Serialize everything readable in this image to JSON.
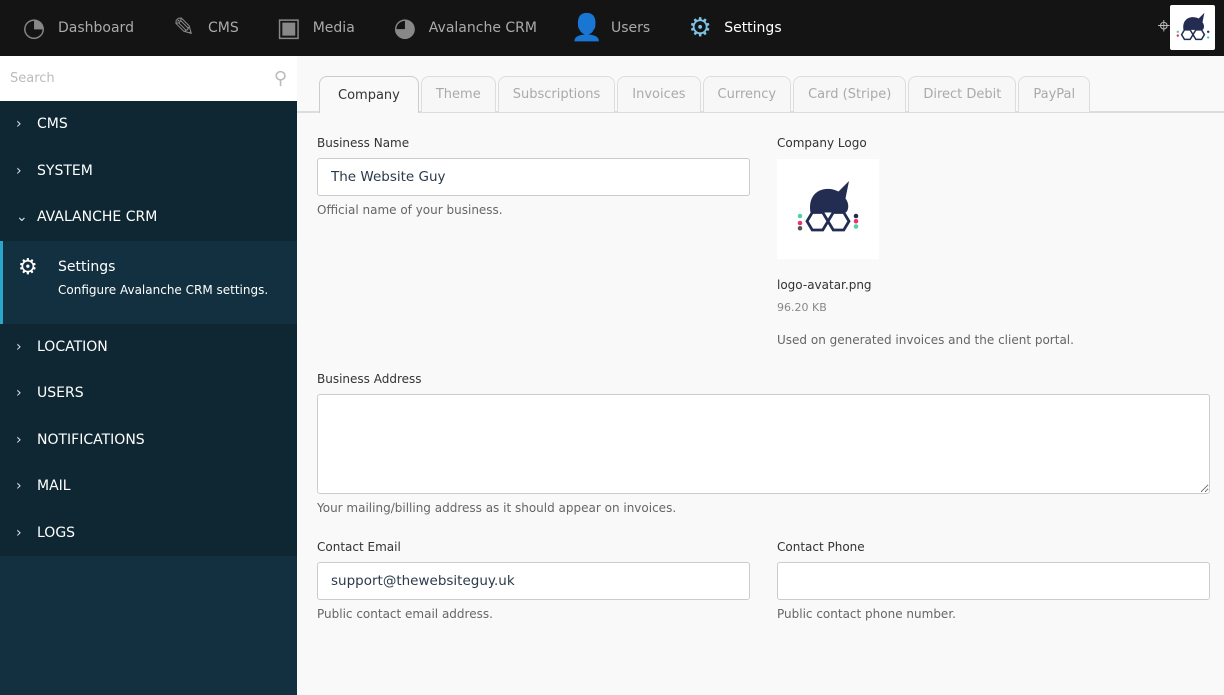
{
  "topnav": [
    {
      "label": "Dashboard",
      "icon": "dashboard-icon"
    },
    {
      "label": "CMS",
      "icon": "cms-icon"
    },
    {
      "label": "Media",
      "icon": "media-icon"
    },
    {
      "label": "Avalanche CRM",
      "icon": "crm-icon"
    },
    {
      "label": "Users",
      "icon": "users-icon"
    },
    {
      "label": "Settings",
      "icon": "settings-icon"
    }
  ],
  "sidebar": {
    "search_placeholder": "Search",
    "items": [
      "CMS",
      "SYSTEM",
      "AVALANCHE CRM",
      "LOCATION",
      "USERS",
      "NOTIFICATIONS",
      "MAIL",
      "LOGS"
    ],
    "active_sub": {
      "title": "Settings",
      "description": "Configure Avalanche CRM settings."
    }
  },
  "tabs": [
    "Company",
    "Theme",
    "Subscriptions",
    "Invoices",
    "Currency",
    "Card (Stripe)",
    "Direct Debit",
    "PayPal"
  ],
  "form": {
    "business_name": {
      "label": "Business Name",
      "value": "The Website Guy",
      "help": "Official name of your business."
    },
    "logo": {
      "label": "Company Logo",
      "filename": "logo-avatar.png",
      "size": "96.20 KB",
      "help": "Used on generated invoices and the client portal."
    },
    "address": {
      "label": "Business Address",
      "value": "",
      "help": "Your mailing/billing address as it should appear on invoices."
    },
    "email": {
      "label": "Contact Email",
      "value": "support@thewebsiteguy.uk",
      "help": "Public contact email address."
    },
    "phone": {
      "label": "Contact Phone",
      "value": "",
      "help": "Public contact phone number."
    }
  }
}
